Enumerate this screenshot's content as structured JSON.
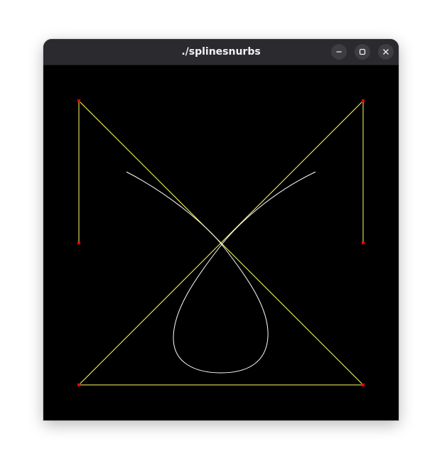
{
  "window": {
    "title": "./splinesnurbs",
    "controls": {
      "minimize": "minimize-icon",
      "maximize": "maximize-icon",
      "close": "close-icon"
    }
  },
  "scene": {
    "background_color": "#000000",
    "control_polygon_color": "#ffff66",
    "control_point_color": "#ff0000",
    "curve_color": "#ffffff"
  }
}
